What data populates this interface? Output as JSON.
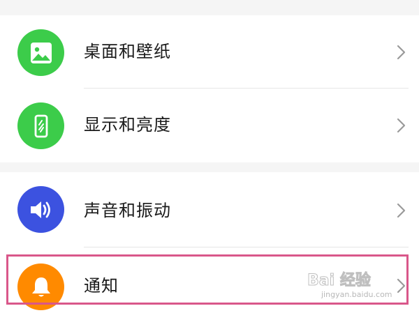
{
  "settings_items": [
    {
      "label": "桌面和壁纸",
      "icon": "image-icon",
      "icon_color": "#3ccc4a"
    },
    {
      "label": "显示和亮度",
      "icon": "phone-display-icon",
      "icon_color": "#3ccc4a"
    },
    {
      "label": "声音和振动",
      "icon": "speaker-icon",
      "icon_color": "#3c52e0"
    },
    {
      "label": "通知",
      "icon": "bell-icon",
      "icon_color": "#ff8a00"
    }
  ],
  "highlight": {
    "color": "#d9578a",
    "target": "通知"
  },
  "watermark": {
    "text": "Bai 经验",
    "url": "jingyan.baidu.com"
  }
}
